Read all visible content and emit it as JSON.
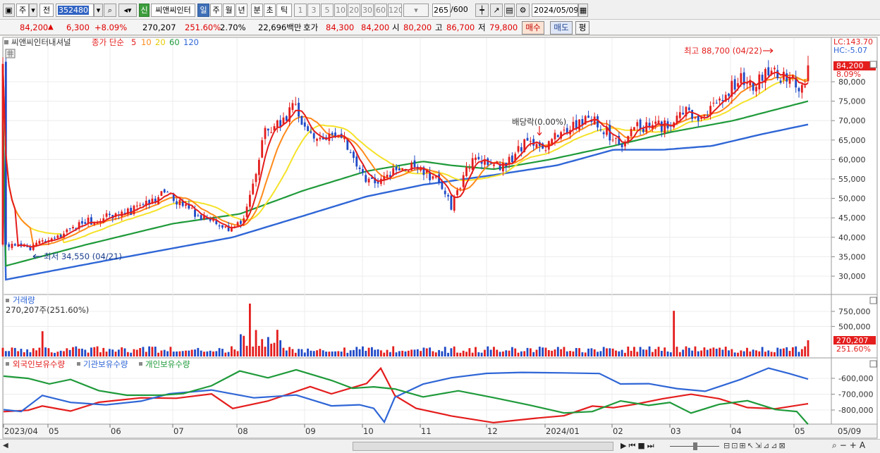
{
  "toolbar": {
    "type_label": "주",
    "prev_label": "전",
    "stock_code": "352480",
    "badge_new": "신",
    "stock_name": "씨앤씨인터",
    "periods": [
      "일",
      "주",
      "월",
      "년",
      "분",
      "초",
      "틱"
    ],
    "active_period": "일",
    "intervals": [
      "1",
      "3",
      "5",
      "10",
      "20",
      "30",
      "60",
      "120"
    ],
    "count": "265",
    "count_total": "/600",
    "date": "2024/05/09"
  },
  "quote": {
    "price": "84,200",
    "change": "6,300",
    "change_pct": "+8.09%",
    "volume": "270,207",
    "volume_pct": "251.60%",
    "turnover": "2.70%",
    "amount": "22,696백만",
    "ask_label": "호가",
    "ask1": "84,300",
    "ask2": "84,200",
    "open_label": "시",
    "open": "80,200",
    "high_label": "고",
    "high": "86,700",
    "low_label": "저",
    "low": "79,800",
    "buy_label": "매수",
    "sell_label": "매도",
    "flat_label": "평"
  },
  "legend": {
    "name": "씨앤씨인터내셔널",
    "ma_label": "종가 단순",
    "ma": [
      {
        "period": "5",
        "color": "#e41d1d"
      },
      {
        "period": "10",
        "color": "#ff8a1a"
      },
      {
        "period": "20",
        "color": "#f5e22a"
      },
      {
        "period": "60",
        "color": "#1f9a3a"
      },
      {
        "period": "120",
        "color": "#2f66d6"
      }
    ]
  },
  "price_panel": {
    "lc": "LC:143.70",
    "hc": "HC:-5.07",
    "current_tag": "84,200",
    "current_pct": "8.09%",
    "high_note": "최고 88,700 (04/22)",
    "low_note": "최저 34,550 (04/21)",
    "dividend_note": "배당락(0.00%)"
  },
  "volume_panel": {
    "title": "거래량",
    "summary": "270,207주(251.60%)",
    "tag_value": "270,207",
    "tag_pct": "251.60%"
  },
  "holdings_panel": {
    "legend": [
      "외국인보유수량",
      "기관보유수량",
      "개인보유수량"
    ],
    "colors": [
      "#e41d1d",
      "#2f66d6",
      "#1f9a3a"
    ]
  },
  "x_axis": {
    "labels": [
      "2023/04",
      "05",
      "06",
      "07",
      "08",
      "09",
      "10",
      "11",
      "12",
      "2024/01",
      "02",
      "03",
      "04",
      "05"
    ],
    "end_label": "05/09"
  },
  "chart_data": [
    {
      "type": "candlestick",
      "title": "씨앤씨인터내셔널",
      "ylim": [
        25000,
        90000
      ],
      "y_ticks": [
        30000,
        35000,
        40000,
        45000,
        50000,
        55000,
        60000,
        65000,
        70000,
        75000,
        80000
      ],
      "y_tick_labels": [
        "30,000",
        "35,000",
        "40,000",
        "45,000",
        "50,000",
        "55,000",
        "60,000",
        "65,000",
        "70,000",
        "75,000",
        "80,000"
      ],
      "x_range": [
        "2023/04",
        "2024/05/09"
      ],
      "series": [
        {
          "name": "5",
          "color": "#e41d1d"
        },
        {
          "name": "10",
          "color": "#ff8a1a"
        },
        {
          "name": "20",
          "color": "#f5e22a"
        },
        {
          "name": "60",
          "color": "#1f9a3a"
        },
        {
          "name": "120",
          "color": "#2f66d6"
        }
      ],
      "key_points": [
        {
          "label": "최저",
          "date": "04/21",
          "value": 34550
        },
        {
          "label": "최고",
          "date": "04/22",
          "value": 88700
        },
        {
          "label": "현재",
          "value": 84200
        }
      ]
    },
    {
      "type": "bar",
      "title": "거래량",
      "ylim": [
        0,
        900000
      ],
      "y_ticks": [
        500000,
        750000
      ],
      "y_tick_labels": [
        "500,000",
        "750,000"
      ],
      "last_value": 270207
    },
    {
      "type": "line",
      "title": "보유수량",
      "series": [
        {
          "name": "외국인보유수량",
          "color": "#e41d1d"
        },
        {
          "name": "기관보유수량",
          "color": "#2f66d6"
        },
        {
          "name": "개인보유수량",
          "color": "#1f9a3a"
        }
      ],
      "y_ticks": [
        -600000,
        -700000,
        -800000
      ],
      "y_tick_labels": [
        "-600,000",
        "-700,000",
        "-800,000"
      ]
    }
  ]
}
